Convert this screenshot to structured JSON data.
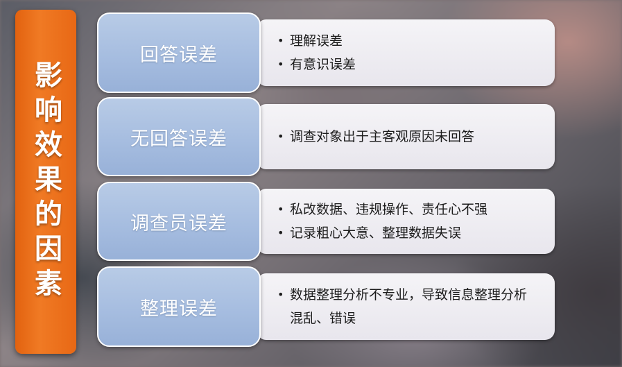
{
  "title": "影响效果的因素",
  "rows": [
    {
      "label": "回答误差",
      "bullets": [
        "理解误差",
        "有意识误差"
      ]
    },
    {
      "label": "无回答误差",
      "bullets": [
        "调查对象出于主客观原因未回答"
      ]
    },
    {
      "label": "调查员误差",
      "bullets": [
        "私改数据、违规操作、责任心不强",
        "记录粗心大意、整理数据失误"
      ]
    },
    {
      "label": "整理误差",
      "bullets": [
        "数据整理分析不专业，导致信息整理分析混乱、错误"
      ]
    }
  ],
  "bullet_symbol": "•",
  "colors": {
    "title_bg": "#f07a24",
    "label_bg": "#a6bde0",
    "content_bg": "#efeef2"
  }
}
